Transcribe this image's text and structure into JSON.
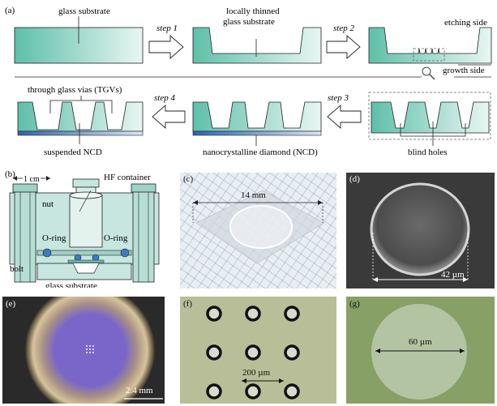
{
  "panel_a": {
    "label": "(a)",
    "glass_substrate": "glass substrate",
    "step1": "step 1",
    "locally_thinned": [
      "locally thinned",
      "glass substrate"
    ],
    "step2": "step 2",
    "etching_side": "etching side",
    "growth_side": "growth side",
    "through_glass_vias": "through glass vias (TGVs)",
    "step4": "step 4",
    "step3": "step 3",
    "suspended_ncd": "suspended NCD",
    "ncd": "nanocrystalline diamond (NCD)",
    "blind_holes": "blind holes"
  },
  "panel_b": {
    "label": "(b)",
    "scale": "1 cm",
    "hf_container": "HF container",
    "nut": "nut",
    "oring_left": "O-ring",
    "oring_right": "O-ring",
    "bolt": "bolt",
    "glass_substrate": "glass substrate"
  },
  "panel_c": {
    "label": "(c)",
    "scale": "14 mm"
  },
  "panel_d": {
    "label": "(d)",
    "scale": "42 µm"
  },
  "panel_e": {
    "label": "(e)",
    "scale": "2.4 mm"
  },
  "panel_f": {
    "label": "(f)",
    "scale": "200 µm"
  },
  "panel_g": {
    "label": "(g)",
    "scale": "60 µm"
  },
  "colors": {
    "glass": "#bfe5dc",
    "glass_edge": "#5cb7a4",
    "ncd_blue": "#3a72b8",
    "photo_d": "#3c3c3c",
    "photo_f": "#b7bd95",
    "photo_g": "#8ca06a"
  }
}
